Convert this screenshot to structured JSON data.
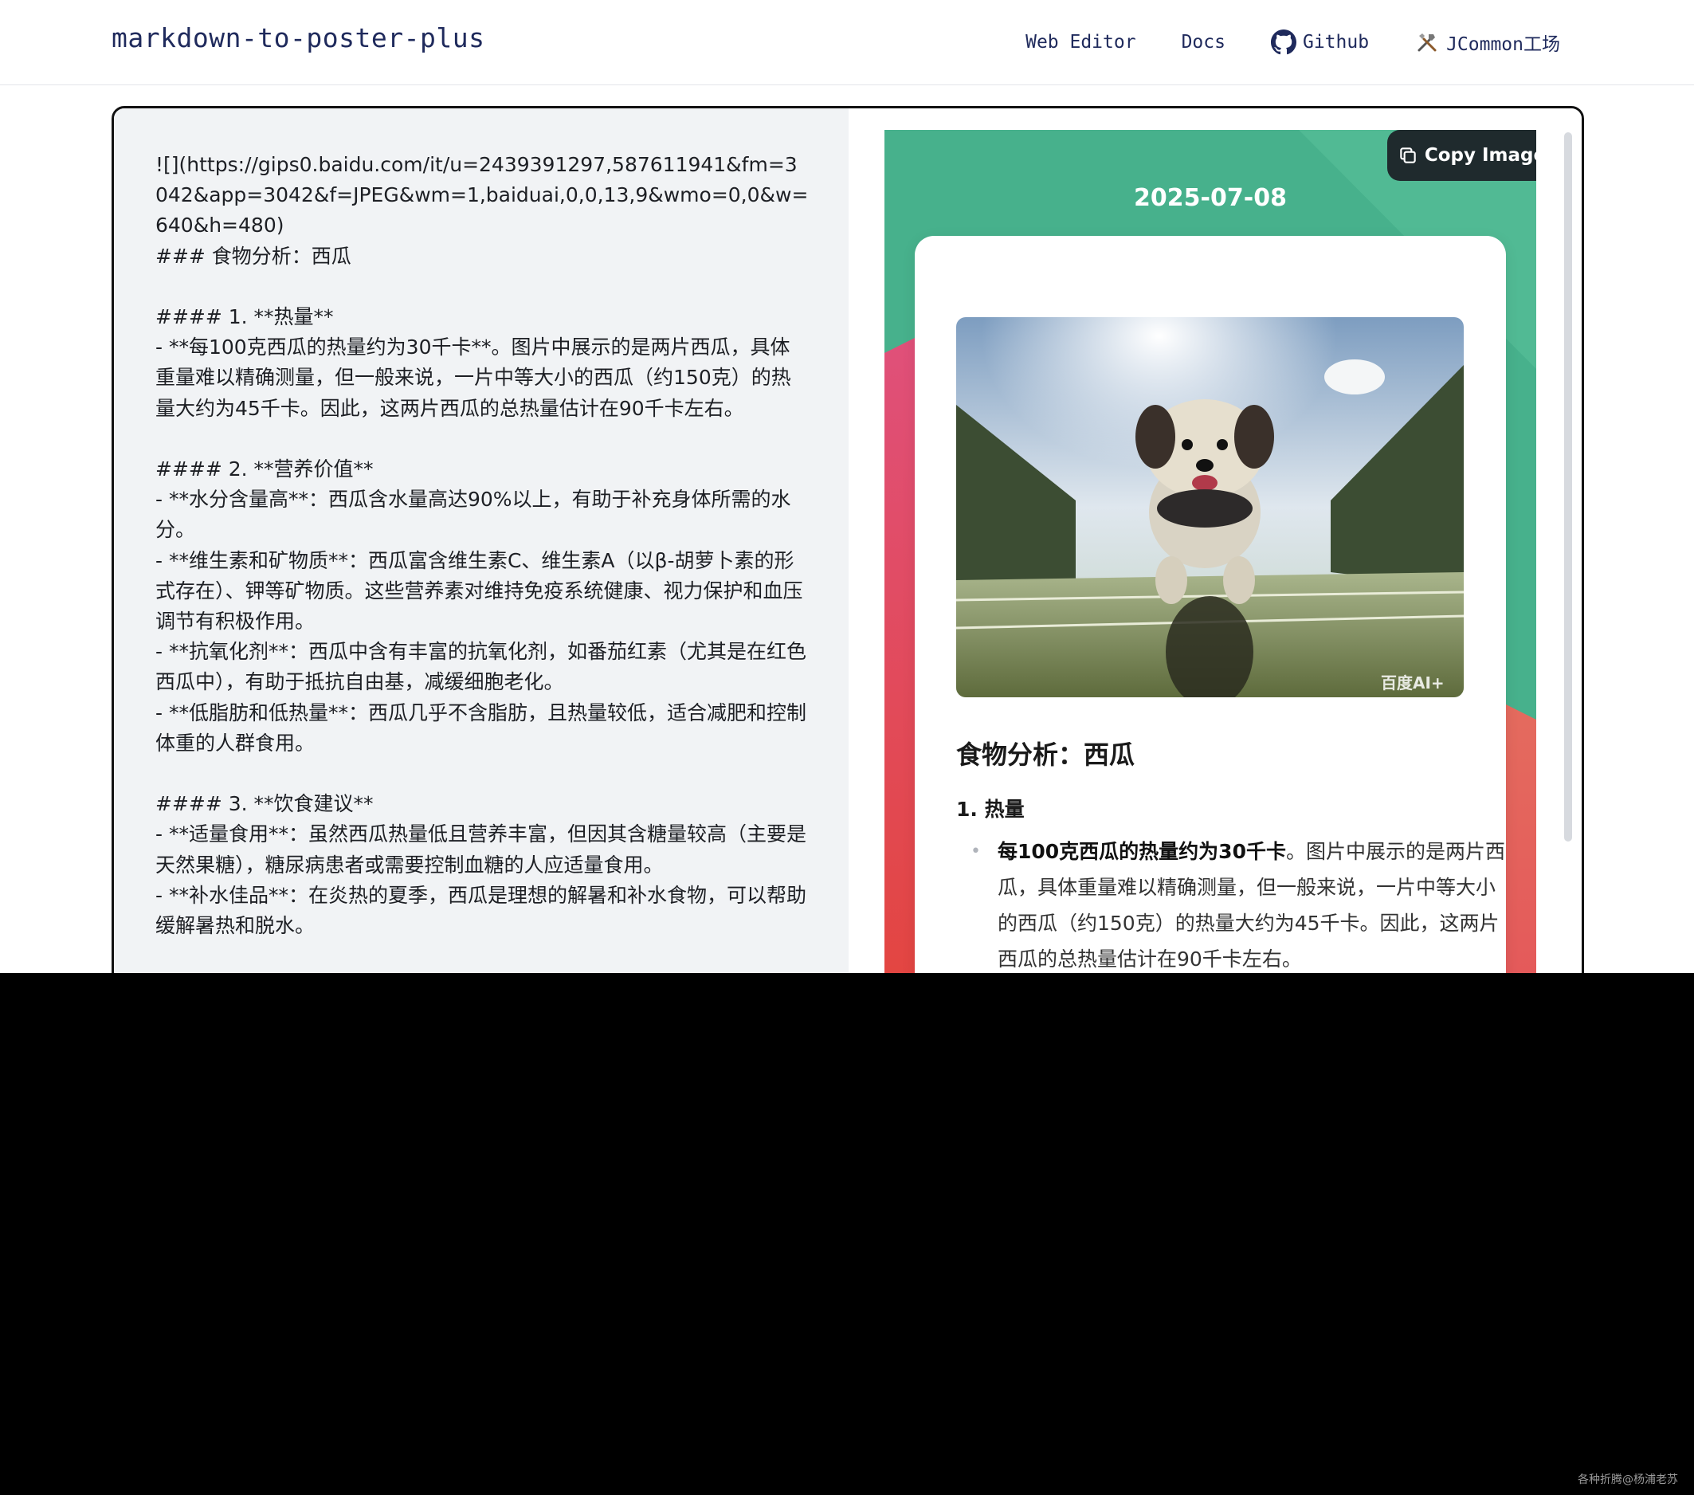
{
  "navbar": {
    "brand": "markdown-to-poster-plus",
    "links": [
      {
        "label": "Web Editor",
        "icon": ""
      },
      {
        "label": "Docs",
        "icon": ""
      },
      {
        "label": "Github",
        "icon": "github-icon"
      },
      {
        "label": "JCommon工场",
        "icon": "tools-icon"
      }
    ]
  },
  "editor": {
    "markdown": "![](https://gips0.baidu.com/it/u=2439391297,587611941&fm=3042&app=3042&f=JPEG&wm=1,baiduai,0,0,13,9&wmo=0,0&w=640&h=480)\n### 食物分析：西瓜\n\n#### 1. **热量**\n- **每100克西瓜的热量约为30千卡**。图片中展示的是两片西瓜，具体重量难以精确测量，但一般来说，一片中等大小的西瓜（约150克）的热量大约为45千卡。因此，这两片西瓜的总热量估计在90千卡左右。\n\n#### 2. **营养价值**\n- **水分含量高**：西瓜含水量高达90%以上，有助于补充身体所需的水分。\n- **维生素和矿物质**：西瓜富含维生素C、维生素A（以β-胡萝卜素的形式存在）、钾等矿物质。这些营养素对维持免疫系统健康、视力保护和血压调节有积极作用。\n- **抗氧化剂**：西瓜中含有丰富的抗氧化剂，如番茄红素（尤其是在红色西瓜中），有助于抵抗自由基，减缓细胞老化。\n- **低脂肪和低热量**：西瓜几乎不含脂肪，且热量较低，适合减肥和控制体重的人群食用。\n\n#### 3. **饮食建议**\n- **适量食用**：虽然西瓜热量低且营养丰富，但因其含糖量较高（主要是天然果糖），糖尿病患者或需要控制血糖的人应适量食用。\n- **补水佳品**：在炎热的夏季，西瓜是理想的解暑和补水食物，可以帮助缓解暑热和脱水。"
  },
  "preview": {
    "copy_button": "Copy Image",
    "date": "2025-07-08",
    "image_watermark": "百度AI+",
    "heading": "食物分析：西瓜",
    "section_title": "1. 热量",
    "bullet_bold": "每100克西瓜的热量约为30千卡",
    "bullet_text": "。图片中展示的是两片西瓜，具体重量难以精确测量，但一般来说，一片中等大小的西瓜（约150克）的热量大约为45千卡。因此，这两片西瓜的总热量估计在90千卡左右。"
  },
  "footer": {
    "watermark": "各种折腾@杨浦老苏"
  },
  "colors": {
    "poster_green": "#47b18c",
    "poster_red": "#e4575f",
    "poster_pink": "#e0507a",
    "brand_text": "#1f2a5c"
  }
}
